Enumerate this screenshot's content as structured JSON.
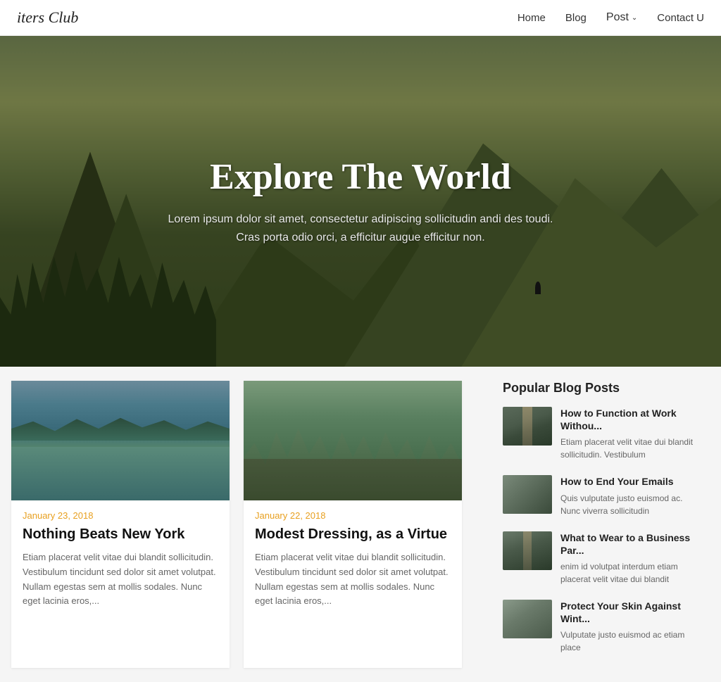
{
  "header": {
    "logo": "iters Club",
    "nav": {
      "items": [
        {
          "label": "Home",
          "link": "#",
          "has_dropdown": false
        },
        {
          "label": "Blog",
          "link": "#",
          "has_dropdown": false
        },
        {
          "label": "Post",
          "link": "#",
          "has_dropdown": true
        },
        {
          "label": "Contact U",
          "link": "#",
          "has_dropdown": false
        }
      ]
    }
  },
  "hero": {
    "title": "Explore The World",
    "subtitle_line1": "Lorem ipsum dolor sit amet, consectetur adipiscing sollicitudin andi des toudi.",
    "subtitle_line2": "Cras porta odio orci, a efficitur augue efficitur non."
  },
  "blog_cards": [
    {
      "date": "January 23, 2018",
      "title": "Nothing Beats New York",
      "excerpt": "Etiam placerat velit vitae dui blandit sollicitudin. Vestibulum tincidunt sed dolor sit amet volutpat. Nullam egestas sem at mollis sodales. Nunc eget lacinia eros,..."
    },
    {
      "date": "January 22, 2018",
      "title": "Modest Dressing, as a Virtue",
      "excerpt": "Etiam placerat velit vitae dui blandit sollicitudin. Vestibulum tincidunt sed dolor sit amet volutpat. Nullam egestas sem at mollis sodales. Nunc eget lacinia eros,..."
    }
  ],
  "sidebar": {
    "title": "Popular Blog Posts",
    "posts": [
      {
        "title": "How to Function at Work Withou...",
        "excerpt": "Etiam placerat velit vitae dui blandit sollicitudin. Vestibulum"
      },
      {
        "title": "How to End Your Emails",
        "excerpt": "Quis vulputate justo euismod ac. Nunc viverra sollicitudin"
      },
      {
        "title": "What to Wear to a Business Par...",
        "excerpt": "enim id volutpat interdum etiam placerat velit vitae dui blandit"
      },
      {
        "title": "Protect Your Skin Against Wint...",
        "excerpt": "Vulputate justo euismod ac etiam place"
      }
    ]
  }
}
